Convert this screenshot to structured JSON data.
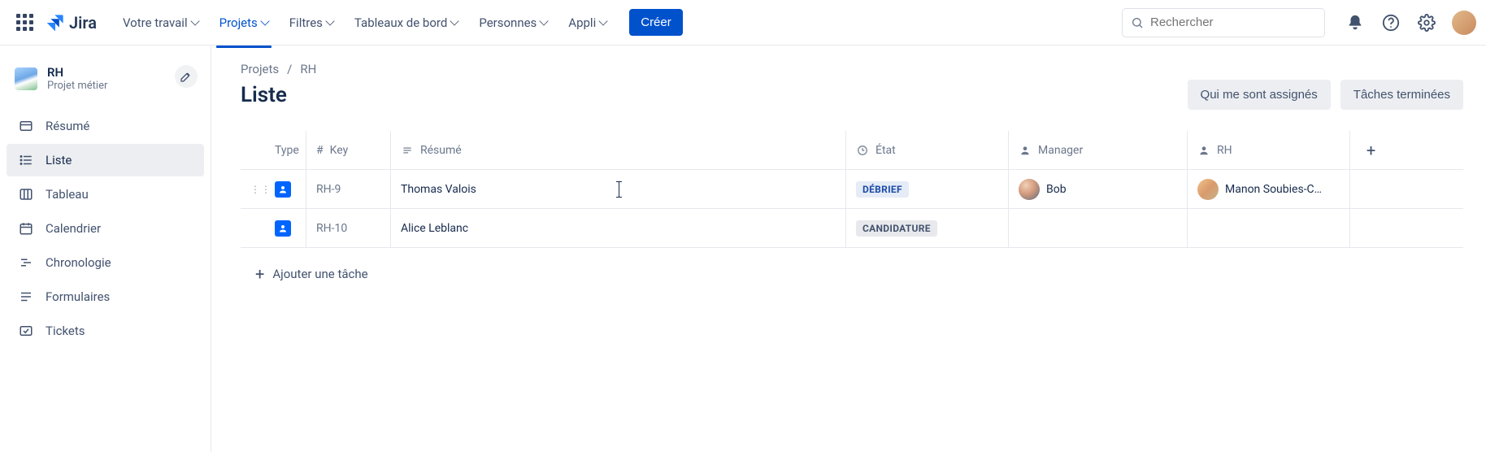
{
  "brand": "Jira",
  "nav": {
    "your_work": "Votre travail",
    "projects": "Projets",
    "filters": "Filtres",
    "dashboards": "Tableaux de bord",
    "people": "Personnes",
    "apps": "Appli",
    "create": "Créer"
  },
  "search": {
    "placeholder": "Rechercher"
  },
  "project": {
    "name": "RH",
    "subtitle": "Projet métier"
  },
  "sidebar": {
    "items": [
      {
        "label": "Résumé"
      },
      {
        "label": "Liste"
      },
      {
        "label": "Tableau"
      },
      {
        "label": "Calendrier"
      },
      {
        "label": "Chronologie"
      },
      {
        "label": "Formulaires"
      },
      {
        "label": "Tickets"
      }
    ]
  },
  "breadcrumbs": {
    "root": "Projets",
    "current": "RH"
  },
  "page_title": "Liste",
  "actions": {
    "assigned": "Qui me sont assignés",
    "done": "Tâches terminées"
  },
  "columns": {
    "type": "Type",
    "key": "Key",
    "summary": "Résumé",
    "status": "État",
    "manager": "Manager",
    "rh": "RH"
  },
  "key_prefix_icon": "#",
  "rows": [
    {
      "key": "RH-9",
      "summary": "Thomas Valois",
      "status": "DÉBRIEF",
      "status_kind": "debrief",
      "manager": "Bob",
      "rh": "Manon Soubies-C…"
    },
    {
      "key": "RH-10",
      "summary": "Alice Leblanc",
      "status": "CANDIDATURE",
      "status_kind": "cand",
      "manager": "",
      "rh": ""
    }
  ],
  "add_task": "Ajouter une tâche"
}
